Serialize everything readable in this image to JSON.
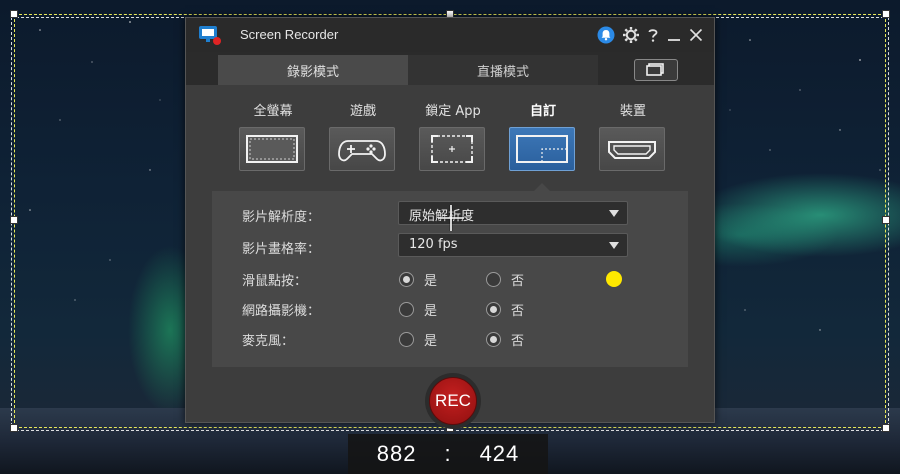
{
  "app": {
    "title": "Screen Recorder"
  },
  "tabs": {
    "record": "錄影模式",
    "live": "直播模式"
  },
  "modes": [
    {
      "label": "全螢幕",
      "icon": "fullscreen-icon"
    },
    {
      "label": "遊戲",
      "icon": "gamepad-icon"
    },
    {
      "label": "鎖定 App",
      "icon": "lock-app-icon"
    },
    {
      "label": "自訂",
      "icon": "custom-region-icon",
      "active": true
    },
    {
      "label": "裝置",
      "icon": "hdmi-device-icon"
    }
  ],
  "settings": {
    "resolution": {
      "label": "影片解析度：",
      "value": "原始解析度"
    },
    "framerate": {
      "label": "影片畫格率：",
      "value": "120 fps"
    },
    "mouse_click": {
      "label": "滑鼠點按：",
      "yes": "是",
      "no": "否",
      "selected": "yes",
      "color": "#ffe800"
    },
    "webcam": {
      "label": "網路攝影機：",
      "yes": "是",
      "no": "否",
      "selected": "no"
    },
    "microphone": {
      "label": "麥克風：",
      "yes": "是",
      "no": "否",
      "selected": "no"
    }
  },
  "rec_button": "REC",
  "selection_size": {
    "width": "882",
    "separator": ":",
    "height": "424"
  },
  "colors": {
    "accent_blue": "#2a5f9c",
    "rec_red": "#b51818",
    "selection_yellow": "#e8e85a"
  }
}
